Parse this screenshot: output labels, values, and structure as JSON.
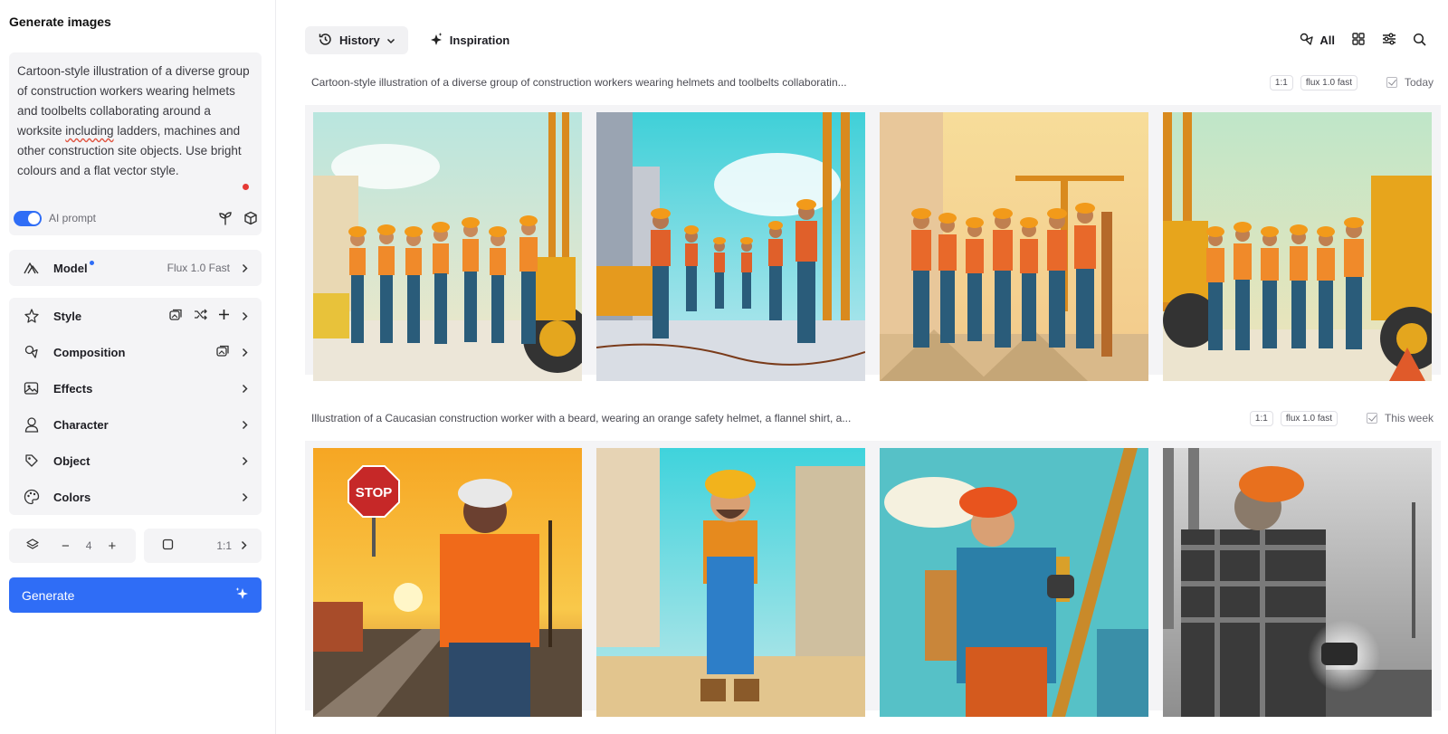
{
  "sidebar": {
    "title": "Generate images",
    "prompt": {
      "before": "Cartoon-style illustration of a diverse group of construction workers wearing helmets and toolbelts collaborating around a worksite ",
      "underlined": "including",
      "after": " ladders, machines and other construction site objects. Use bright colours and a flat vector style."
    },
    "ai_prompt_label": "AI prompt",
    "ai_prompt_enabled": true,
    "model": {
      "label": "Model",
      "value": "Flux 1.0 Fast"
    },
    "options": [
      {
        "label": "Style",
        "icon": "style-icon"
      },
      {
        "label": "Composition",
        "icon": "composition-icon"
      },
      {
        "label": "Effects",
        "icon": "effects-icon"
      },
      {
        "label": "Character",
        "icon": "character-icon"
      },
      {
        "label": "Object",
        "icon": "object-icon"
      },
      {
        "label": "Colors",
        "icon": "palette-icon"
      }
    ],
    "count": "4",
    "ratio": "1:1",
    "generate_label": "Generate"
  },
  "topbar": {
    "history_label": "History",
    "inspiration_label": "Inspiration",
    "filter_label": "All"
  },
  "groups": [
    {
      "title": "Cartoon-style illustration of a diverse group of construction workers wearing helmets and toolbelts collaboratin...",
      "ratio": "1:1",
      "model": "flux 1.0 fast",
      "when": "Today",
      "images": [
        "group-workers-excavator",
        "group-workers-scaffold",
        "group-workers-crane",
        "group-workers-bulldozer"
      ]
    },
    {
      "title": "Illustration of a Caucasian construction worker with a beard, wearing an orange safety helmet, a flannel shirt, a...",
      "ratio": "1:1",
      "model": "flux 1.0 fast",
      "when": "This week",
      "images": [
        "worker-stop-sign-sunset",
        "worker-overalls-cartoon",
        "worker-ladder-crane",
        "worker-welding-bridge"
      ]
    }
  ]
}
